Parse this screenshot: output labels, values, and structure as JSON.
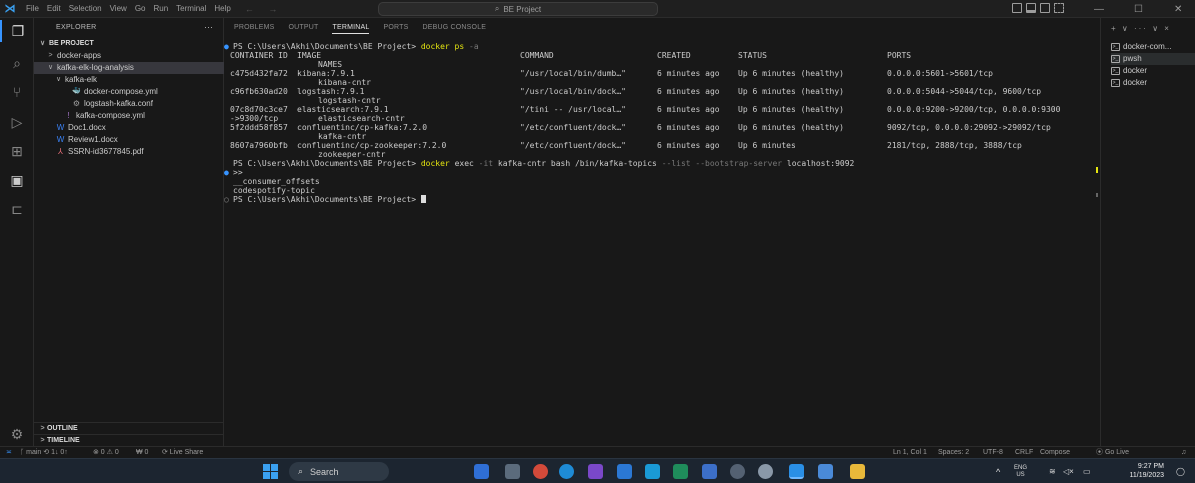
{
  "titlebar": {
    "menu": [
      "File",
      "Edit",
      "Selection",
      "View",
      "Go",
      "Run",
      "Terminal",
      "Help"
    ],
    "nav": "← →",
    "search": "BE Project"
  },
  "activitybar": {
    "icons": [
      "explorer-icon",
      "search-icon",
      "source-control-icon",
      "run-debug-icon",
      "extensions-icon",
      "docker-icon",
      "remote-explorer-icon",
      "settings-icon"
    ]
  },
  "sidebar": {
    "title": "EXPLORER",
    "more": "···",
    "tree": [
      {
        "label": "BE PROJECT",
        "indent": 0,
        "twisty": "∨",
        "bold": true
      },
      {
        "label": "docker-apps",
        "indent": 1,
        "twisty": ">"
      },
      {
        "label": "kafka-elk-log-analysis",
        "indent": 1,
        "twisty": "∨",
        "selected": true
      },
      {
        "label": "kafka-elk",
        "indent": 2,
        "twisty": "∨"
      },
      {
        "label": "docker-compose.yml",
        "indent": 3,
        "icon": "whale",
        "color": "#e06c75"
      },
      {
        "label": "logstash-kafka.conf",
        "indent": 3,
        "icon": "gear",
        "color": "#9d9d9d"
      },
      {
        "label": "kafka-compose.yml",
        "indent": 2,
        "icon": "!",
        "color": "#a074c4"
      },
      {
        "label": "Doc1.docx",
        "indent": 1,
        "icon": "W",
        "color": "#3b82f6"
      },
      {
        "label": "Review1.docx",
        "indent": 1,
        "icon": "W",
        "color": "#3b82f6"
      },
      {
        "label": "SSRN-id3677845.pdf",
        "indent": 1,
        "icon": "pdf",
        "color": "#e06c75"
      }
    ],
    "outline": "OUTLINE",
    "timeline": "TIMELINE"
  },
  "panel": {
    "tabs": [
      "PROBLEMS",
      "OUTPUT",
      "TERMINAL",
      "PORTS",
      "DEBUG CONSOLE"
    ],
    "active_tab": "TERMINAL"
  },
  "terminal": {
    "prompt_ps": "PS C:\\Users\\Akhi\\Documents\\BE Project> ",
    "cmd1": "docker ps",
    "cmd1_flag": " -a",
    "headers": {
      "container_id": "CONTAINER ID",
      "image": "IMAGE",
      "names": "NAMES",
      "command": "COMMAND",
      "created": "CREATED",
      "status": "STATUS",
      "ports": "PORTS"
    },
    "rows": [
      {
        "id": "c475d432fa72",
        "image": "kibana:7.9.1",
        "name": "kibana-cntr",
        "command": "\"/usr/local/bin/dumb…\"",
        "created": "6 minutes ago",
        "status": "Up 6 minutes (healthy)",
        "ports": "0.0.0.0:5601->5601/tcp",
        "ports2": ""
      },
      {
        "id": "c96fb630ad20",
        "image": "logstash:7.9.1",
        "name": "logstash-cntr",
        "command": "\"/usr/local/bin/dock…\"",
        "created": "6 minutes ago",
        "status": "Up 6 minutes (healthy)",
        "ports": "0.0.0.0:5044->5044/tcp, 9600/tcp",
        "ports2": ""
      },
      {
        "id": "07c8d70c3ce7",
        "image": "elasticsearch:7.9.1",
        "name": "elasticsearch-cntr",
        "command": "\"/tini -- /usr/local…\"",
        "created": "6 minutes ago",
        "status": "Up 6 minutes (healthy)",
        "ports": "0.0.0.0:9200->9200/tcp, 0.0.0.0:9300",
        "ports2": "->9300/tcp"
      },
      {
        "id": "5f2ddd58f857",
        "image": "confluentinc/cp-kafka:7.2.0",
        "name": "kafka-cntr",
        "command": "\"/etc/confluent/dock…\"",
        "created": "6 minutes ago",
        "status": "Up 6 minutes (healthy)",
        "ports": "9092/tcp, 0.0.0.0:29092->29092/tcp",
        "ports2": ""
      },
      {
        "id": "8607a7960bfb",
        "image": "confluentinc/cp-zookeeper:7.2.0",
        "name": "zookeeper-cntr",
        "command": "\"/etc/confluent/dock…\"",
        "created": "6 minutes ago",
        "status": "Up 6 minutes",
        "ports": "2181/tcp, 2888/tcp, 3888/tcp",
        "ports2": ""
      }
    ],
    "cmd2_pre": "docker",
    "cmd2_mid": " exec ",
    "cmd2_flag1": "-it",
    "cmd2_mid2": " kafka-cntr bash /bin/kafka-topics ",
    "cmd2_flag2": "--list --bootstrap-server",
    "cmd2_end": " localhost:9092",
    "continuation": ">>",
    "topics": [
      "__consumer_offsets",
      "codespotify-topic"
    ]
  },
  "terminal_list": {
    "top": "+ ∨ ··· ∨ ×",
    "items": [
      "docker-com...",
      "pwsh",
      "docker",
      "docker"
    ],
    "selected_index": 1
  },
  "statusbar": {
    "remote": "≍",
    "branch": "ᚴ main ⟲ 1↓ 0↑",
    "problems": "⊗ 0 ⚠ 0",
    "ports": "₩ 0",
    "liveshare": "⟳ Live Share",
    "position": "Ln 1, Col 1",
    "spaces": "Spaces: 2",
    "encoding": "UTF-8",
    "eol": "CRLF",
    "language": "Compose",
    "golive": "⦿ Go Live",
    "bell": "🔔"
  },
  "taskbar": {
    "search": "Search",
    "lang1": "ENG",
    "lang2": "US",
    "time": "9:27 PM",
    "date": "11/19/2023",
    "caret": "^"
  },
  "colors": {
    "accent": "#3794ff",
    "terminal_yellow": "#e5e510",
    "background": "#181818"
  }
}
